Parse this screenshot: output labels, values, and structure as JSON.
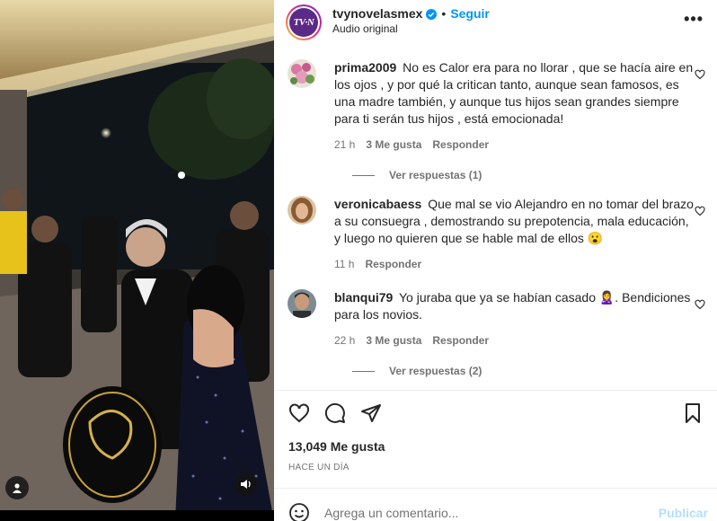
{
  "header": {
    "username": "tvynovelasmex",
    "separator": "•",
    "follow_label": "Seguir",
    "audio_label": "Audio original",
    "avatar_logo_text": "TV·N",
    "more_icon": "more-options-icon"
  },
  "comments": [
    {
      "username": "prima2009",
      "text": "No es Calor era para no llorar , que se hacía aire en los ojos , y por qué la critican tanto, aunque sean famosos, es una madre también, y aunque tus hijos sean grandes siempre para ti serán tus hijos , está emocionada!",
      "time": "21 h",
      "likes": "3 Me gusta",
      "reply_label": "Responder",
      "view_replies": "Ver respuestas (1)"
    },
    {
      "username": "veronicabaess",
      "text": "Que mal se vio Alejandro en no tomar del brazo a su consuegra , demostrando su prepotencia, mala educación, y luego no quieren que se hable mal de ellos 😮",
      "time": "11 h",
      "reply_label": "Responder"
    },
    {
      "username": "blanqui79",
      "text": "Yo juraba que ya se habían casado 🙎‍♀️. Bendiciones para los novios.",
      "time": "22 h",
      "likes": "3 Me gusta",
      "reply_label": "Responder",
      "view_replies": "Ver respuestas (2)"
    }
  ],
  "post": {
    "likes": "13,049 Me gusta",
    "timestamp": "HACE UN DÍA"
  },
  "composer": {
    "placeholder": "Agrega un comentario...",
    "publish_label": "Publicar"
  },
  "colors": {
    "accent": "#0095f6",
    "muted": "#737373",
    "publish_disabled": "#b2dffc"
  }
}
